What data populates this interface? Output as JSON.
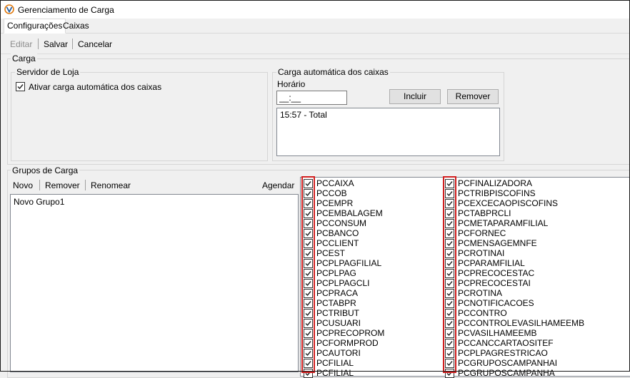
{
  "window": {
    "title": "Gerenciamento de Carga",
    "icon": "app-logo-icon"
  },
  "tabs": [
    {
      "label": "Configurações",
      "active": true
    },
    {
      "label": "Caixas",
      "active": false
    }
  ],
  "toolbar": {
    "edit_label": "Editar",
    "save_label": "Salvar",
    "cancel_label": "Cancelar"
  },
  "carga": {
    "legend": "Carga",
    "servidor": {
      "legend": "Servidor de Loja",
      "auto_checkbox_label": "Ativar carga automática dos caixas",
      "auto_checked": true
    },
    "automatica": {
      "legend": "Carga automática dos caixas",
      "horario_label": "Horário",
      "horario_value": "__:__",
      "incluir_label": "Incluir",
      "remover_label": "Remover",
      "schedule_items": [
        "15:57 - Total"
      ]
    }
  },
  "grupos": {
    "legend": "Grupos de Carga",
    "novo_label": "Novo",
    "remover_label": "Remover",
    "renomear_label": "Renomear",
    "agendar_label": "Agendar",
    "groups": [
      "Novo Grupo1"
    ],
    "tables_left": [
      "PCCAIXA",
      "PCCOB",
      "PCEMPR",
      "PCEMBALAGEM",
      "PCCONSUM",
      "PCBANCO",
      "PCCLIENT",
      "PCEST",
      "PCPLPAGFILIAL",
      "PCPLPAG",
      "PCPLPAGCLI",
      "PCPRACA",
      "PCTABPR",
      "PCTRIBUT",
      "PCUSUARI",
      "PCPRECOPROM",
      "PCFORMPROD",
      "PCAUTORI",
      "PCFILIAL",
      "PCFILIAL"
    ],
    "tables_right": [
      "PCFINALIZADORA",
      "PCTRIBPISCOFINS",
      "PCEXCECAOPISCOFINS",
      "PCTABPRCLI",
      "PCMETAPARAMFILIAL",
      "PCFORNEC",
      "PCMENSAGEMNFE",
      "PCROTINAI",
      "PCPARAMFILIAL",
      "PCPRECOCESTAC",
      "PCPRECOCESTAI",
      "PCROTINA",
      "PCNOTIFICACOES",
      "PCCONTRO",
      "PCCONTROLEVASILHAMEEMB",
      "PCVASILHAMEEMB",
      "PCCANCCARTAOSITEF",
      "PCPLPAGRESTRICAO",
      "PCGRUPOSCAMPANHAI",
      "PCGRUPOSCAMPANHA"
    ]
  }
}
